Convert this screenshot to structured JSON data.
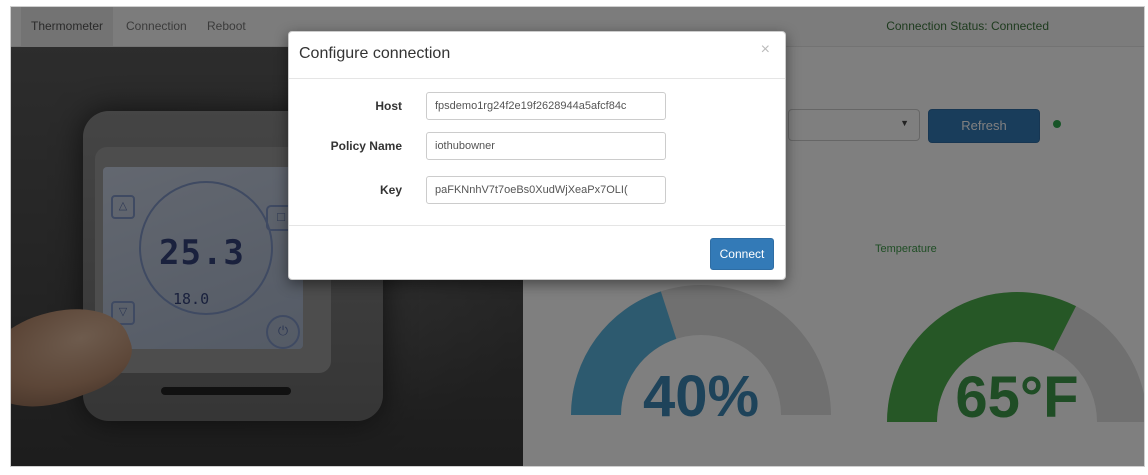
{
  "navbar": {
    "items": [
      {
        "label": "Thermometer",
        "active": true
      },
      {
        "label": "Connection",
        "active": false
      },
      {
        "label": "Reboot",
        "active": false
      }
    ],
    "connection_status": "Connection Status: Connected"
  },
  "thermostat_photo": {
    "display_main": "25.3",
    "display_sub": "18.0"
  },
  "dashboard": {
    "device_select": {
      "selected": ""
    },
    "refresh_label": "Refresh",
    "live_indicator_color": "#2fa84f",
    "gauges": [
      {
        "id": "humidity",
        "label": "",
        "value": "40%",
        "fill_fraction": 0.4,
        "color": "#5ab4de"
      },
      {
        "id": "temperature",
        "label": "Temperature",
        "value": "65°F",
        "fill_fraction": 0.65,
        "color": "#4cae4c"
      }
    ]
  },
  "modal": {
    "title": "Configure connection",
    "close_glyph": "×",
    "fields": [
      {
        "label": "Host",
        "value": "fpsdemo1rg24f2e19f2628944a5afcf84c"
      },
      {
        "label": "Policy Name",
        "value": "iothubowner"
      },
      {
        "label": "Key",
        "value": "paFKNnhV7t7oeBs0XudWjXeaPx7OLI("
      }
    ],
    "connect_label": "Connect"
  },
  "colors": {
    "primary_button": "#337ab7",
    "status_text": "#3c763d",
    "humidity": "#5ab4de",
    "temperature": "#4cae4c"
  }
}
